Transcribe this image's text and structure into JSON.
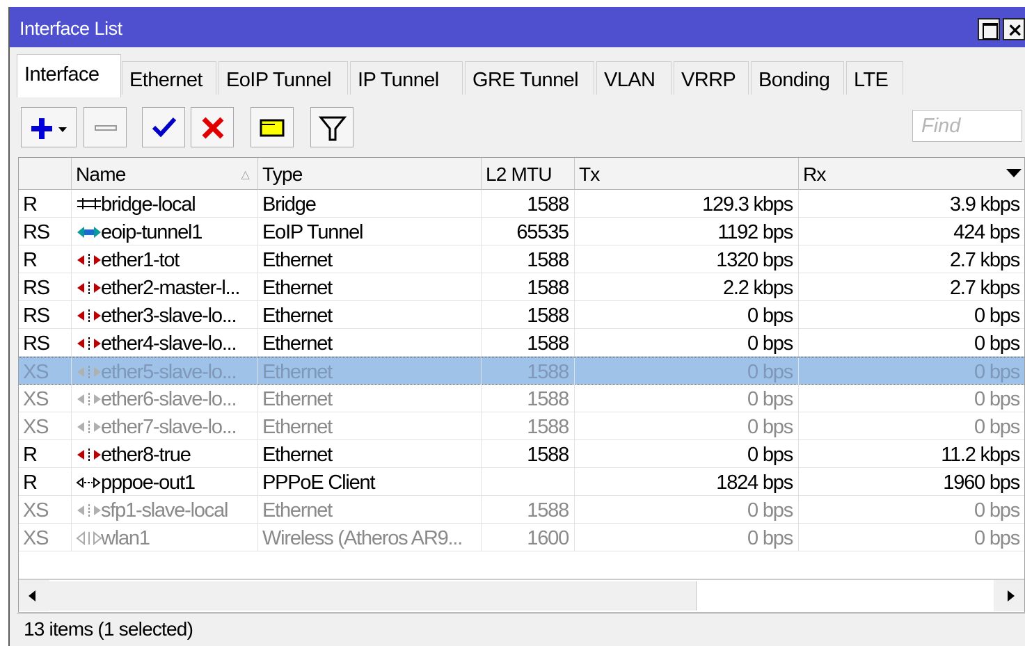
{
  "window": {
    "title": "Interface List",
    "maximize_icon": "maximize-icon",
    "close_icon": "close-icon",
    "title_color": "#4e50cf"
  },
  "tabs": [
    {
      "label": "Interface",
      "active": true
    },
    {
      "label": "Ethernet"
    },
    {
      "label": "EoIP Tunnel"
    },
    {
      "label": "IP Tunnel"
    },
    {
      "label": "GRE Tunnel"
    },
    {
      "label": "VLAN"
    },
    {
      "label": "VRRP"
    },
    {
      "label": "Bonding"
    },
    {
      "label": "LTE"
    }
  ],
  "toolbar": {
    "add_icon": "plus-dropdown-icon",
    "remove_icon": "minus-icon",
    "enable_icon": "checkmark-icon",
    "disable_icon": "x-icon",
    "comment_icon": "comment-icon",
    "filter_icon": "filter-icon",
    "find_placeholder": "Find"
  },
  "table": {
    "columns": [
      "",
      "Name",
      "Type",
      "L2 MTU",
      "Tx",
      "Rx"
    ],
    "sort_indicator": "△",
    "rows": [
      {
        "flags": "R",
        "icon": "bridge-icon",
        "name": "bridge-local",
        "type": "Bridge",
        "l2mtu": "1588",
        "tx": "129.3 kbps",
        "rx": "3.9 kbps",
        "state": "normal"
      },
      {
        "flags": "RS",
        "icon": "eoip-tunnel-icon",
        "name": "eoip-tunnel1",
        "type": "EoIP Tunnel",
        "l2mtu": "65535",
        "tx": "1192 bps",
        "rx": "424 bps",
        "state": "normal"
      },
      {
        "flags": "R",
        "icon": "ethernet-icon",
        "name": "ether1-tot",
        "type": "Ethernet",
        "l2mtu": "1588",
        "tx": "1320 bps",
        "rx": "2.7 kbps",
        "state": "normal"
      },
      {
        "flags": "RS",
        "icon": "ethernet-icon",
        "name": "ether2-master-l...",
        "type": "Ethernet",
        "l2mtu": "1588",
        "tx": "2.2 kbps",
        "rx": "2.7 kbps",
        "state": "normal"
      },
      {
        "flags": "RS",
        "icon": "ethernet-icon",
        "name": "ether3-slave-lo...",
        "type": "Ethernet",
        "l2mtu": "1588",
        "tx": "0 bps",
        "rx": "0 bps",
        "state": "normal"
      },
      {
        "flags": "RS",
        "icon": "ethernet-icon",
        "name": "ether4-slave-lo...",
        "type": "Ethernet",
        "l2mtu": "1588",
        "tx": "0 bps",
        "rx": "0 bps",
        "state": "normal"
      },
      {
        "flags": "XS",
        "icon": "ethernet-icon",
        "name": "ether5-slave-lo...",
        "type": "Ethernet",
        "l2mtu": "1588",
        "tx": "0 bps",
        "rx": "0 bps",
        "state": "selected"
      },
      {
        "flags": "XS",
        "icon": "ethernet-icon",
        "name": "ether6-slave-lo...",
        "type": "Ethernet",
        "l2mtu": "1588",
        "tx": "0 bps",
        "rx": "0 bps",
        "state": "disabled"
      },
      {
        "flags": "XS",
        "icon": "ethernet-icon",
        "name": "ether7-slave-lo...",
        "type": "Ethernet",
        "l2mtu": "1588",
        "tx": "0 bps",
        "rx": "0 bps",
        "state": "disabled"
      },
      {
        "flags": "R",
        "icon": "ethernet-icon",
        "name": "ether8-true",
        "type": "Ethernet",
        "l2mtu": "1588",
        "tx": "0 bps",
        "rx": "11.2 kbps",
        "state": "normal"
      },
      {
        "flags": "R",
        "icon": "pppoe-icon",
        "name": "pppoe-out1",
        "type": "PPPoE Client",
        "l2mtu": "",
        "tx": "1824 bps",
        "rx": "1960 bps",
        "state": "normal"
      },
      {
        "flags": "XS",
        "icon": "ethernet-icon",
        "name": "sfp1-slave-local",
        "type": "Ethernet",
        "l2mtu": "1588",
        "tx": "0 bps",
        "rx": "0 bps",
        "state": "disabled"
      },
      {
        "flags": "XS",
        "icon": "wireless-icon",
        "name": "wlan1",
        "type": "Wireless (Atheros AR9...",
        "l2mtu": "1600",
        "tx": "0 bps",
        "rx": "0 bps",
        "state": "disabled"
      }
    ]
  },
  "status": {
    "text": "13 items (1 selected)"
  }
}
